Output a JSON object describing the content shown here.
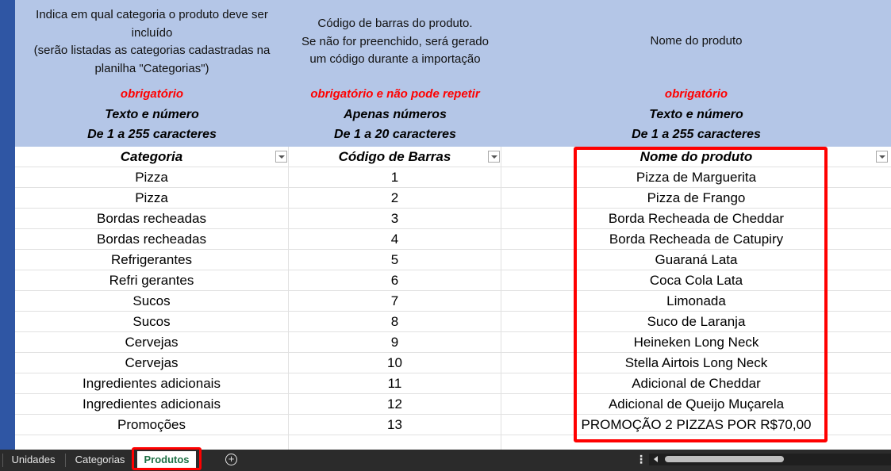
{
  "header": {
    "col1": {
      "desc": [
        "Indica em qual categoria o produto deve ser",
        "incluído",
        "(serão listadas as categorias cadastradas na",
        "planilha \"Categorias\")"
      ],
      "req": "obrigatório",
      "fmt1": "Texto e número",
      "fmt2": "De 1 a 255 caracteres"
    },
    "col2": {
      "desc": [
        "Código de barras do produto.",
        "Se não for preenchido, será gerado",
        "um código durante a importação"
      ],
      "req": "obrigatório e não pode repetir",
      "fmt1": "Apenas números",
      "fmt2": "De 1 a 20 caracteres"
    },
    "col3": {
      "desc": [
        "Nome do produto"
      ],
      "req": "obrigatório",
      "fmt1": "Texto e número",
      "fmt2": "De 1 a 255 caracteres"
    }
  },
  "table": {
    "columns": [
      "Categoria",
      "Código de Barras",
      "Nome do produto"
    ],
    "rows": [
      [
        "Pizza",
        "1",
        "Pizza de Marguerita"
      ],
      [
        "Pizza",
        "2",
        "Pizza de Frango"
      ],
      [
        "Bordas recheadas",
        "3",
        "Borda Recheada de Cheddar"
      ],
      [
        "Bordas recheadas",
        "4",
        "Borda Recheada de Catupiry"
      ],
      [
        "Refrigerantes",
        "5",
        "Guaraná Lata"
      ],
      [
        "Refri gerantes",
        "6",
        "Coca Cola Lata"
      ],
      [
        "Sucos",
        "7",
        "Limonada"
      ],
      [
        "Sucos",
        "8",
        "Suco de Laranja"
      ],
      [
        "Cervejas",
        "9",
        "Heineken Long Neck"
      ],
      [
        "Cervejas",
        "10",
        "Stella Airtois Long Neck"
      ],
      [
        "Ingredientes adicionais",
        "11",
        "Adicional de Cheddar"
      ],
      [
        "Ingredientes adicionais",
        "12",
        "Adicional de Queijo Muçarela"
      ],
      [
        "Promoções",
        "13",
        "PROMOÇÃO 2 PIZZAS POR R$70,00"
      ],
      [
        "",
        "",
        ""
      ]
    ]
  },
  "sheet_tabs": [
    {
      "label": "Unidades",
      "active": false
    },
    {
      "label": "Categorias",
      "active": false
    },
    {
      "label": "Produtos",
      "active": true
    }
  ],
  "icons": {
    "add_sheet": "plus-circle-icon",
    "more": "vertical-ellipsis-icon",
    "filter": "dropdown-filter-icon",
    "scroll_left": "scroll-left-arrow-icon"
  },
  "colors": {
    "header_band": "#b4c6e7",
    "required_text": "#ff0000",
    "highlight_box": "#ff0000",
    "active_tab_text": "#1e7145",
    "sheet_edge": "#2f56a4"
  }
}
